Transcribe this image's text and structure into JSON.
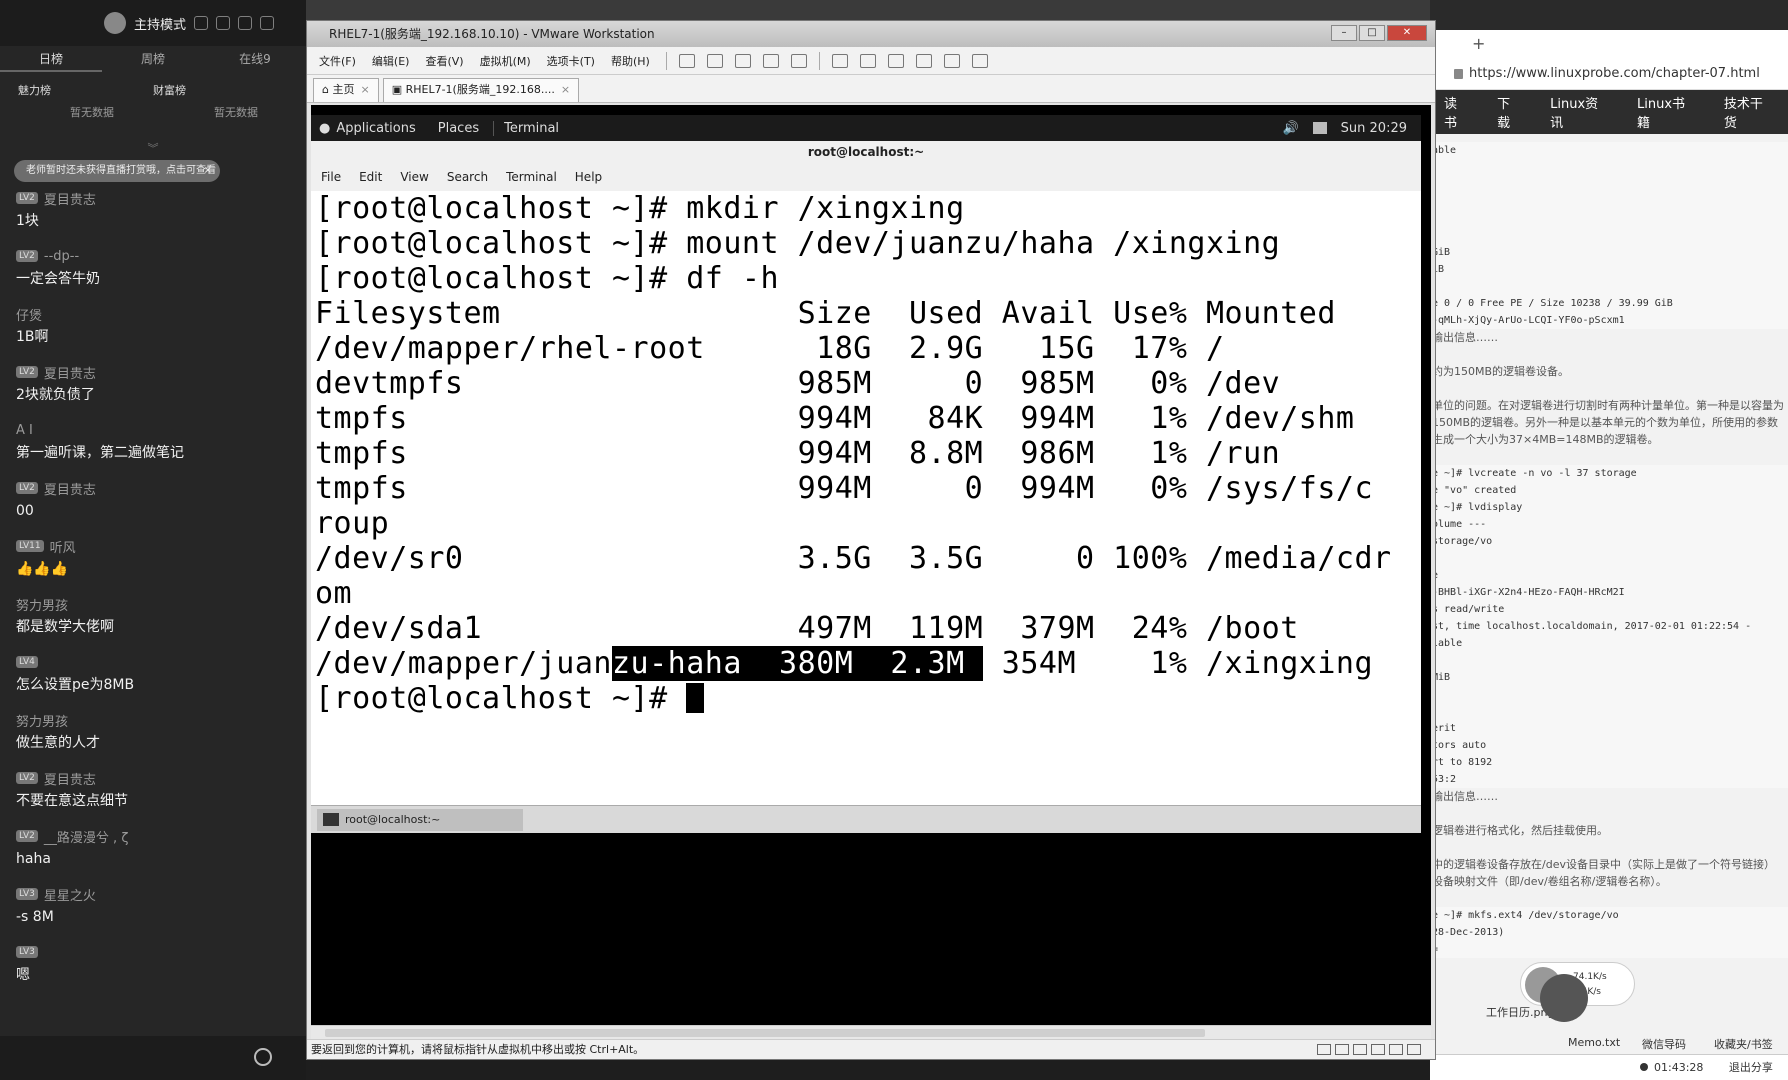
{
  "live_panel": {
    "mode_label": "主持模式",
    "tabs": [
      "日榜",
      "周榜",
      "在线9"
    ],
    "rank_labels": [
      "魅力榜",
      "财富榜"
    ],
    "no_data": [
      "暂无数据",
      "暂无数据"
    ],
    "notice": "老师暂时还未获得直播打赏哦，点击可查看",
    "notice_close": "×",
    "messages": [
      {
        "level": "LV2",
        "user": "夏目贵志",
        "text": "1块"
      },
      {
        "level": "LV2",
        "user": "--dp--",
        "text": "一定会答牛奶"
      },
      {
        "level": "",
        "user": "仔煲",
        "text": "1B啊"
      },
      {
        "level": "LV2",
        "user": "夏目贵志",
        "text": "2块就负债了"
      },
      {
        "level": "",
        "user": "A   I",
        "text": "第一遍听课，第二遍做笔记"
      },
      {
        "level": "LV2",
        "user": "夏目贵志",
        "text": "00"
      },
      {
        "level": "LV11",
        "user": "听风",
        "text": "👍👍👍"
      },
      {
        "level": "",
        "user": "努力男孩",
        "text": "都是数学大佬啊"
      },
      {
        "level": "LV4",
        "user": "",
        "text": "怎么设置pe为8MB"
      },
      {
        "level": "",
        "user": "努力男孩",
        "text": "做生意的人才"
      },
      {
        "level": "LV2",
        "user": "夏目贵志",
        "text": "不要在意这点细节"
      },
      {
        "level": "LV2",
        "user": "__路漫漫兮 , ζ",
        "text": "haha"
      },
      {
        "level": "LV3",
        "user": "星星之火",
        "text": "-s 8M"
      },
      {
        "level": "LV3",
        "user": "",
        "text": "嗯"
      }
    ]
  },
  "vmware": {
    "title": "RHEL7-1(服务端_192.168.10.10) - VMware Workstation",
    "menu": [
      "文件(F)",
      "编辑(E)",
      "查看(V)",
      "虚拟机(M)",
      "选项卡(T)",
      "帮助(H)"
    ],
    "tabs": [
      {
        "label": "主页"
      },
      {
        "label": "RHEL7-1(服务端_192.168...."
      }
    ],
    "status_text": "要返回到您的计算机，请将鼠标指针从虚拟机中移出或按 Ctrl+Alt。"
  },
  "gnome": {
    "applications": "Applications",
    "places": "Places",
    "terminal_indicator": "Terminal",
    "clock": "Sun 20:29"
  },
  "terminal": {
    "title": "root@localhost:~",
    "menu": [
      "File",
      "Edit",
      "View",
      "Search",
      "Terminal",
      "Help"
    ],
    "lines": [
      "[root@localhost ~]# mkdir /xingxing",
      "[root@localhost ~]# mount /dev/juanzu/haha /xingxing",
      "[root@localhost ~]# df -h",
      "Filesystem                Size  Used Avail Use% Mounted",
      "/dev/mapper/rhel-root      18G  2.9G   15G  17% /",
      "devtmpfs                  985M     0  985M   0% /dev",
      "tmpfs                     994M   84K  994M   1% /dev/shm",
      "tmpfs                     994M  8.8M  986M   1% /run",
      "tmpfs                     994M     0  994M   0% /sys/fs/c",
      "roup",
      "/dev/sr0                  3.5G  3.5G     0 100% /media/cdr",
      "om",
      "/dev/sda1                 497M  119M  379M  24% /boot"
    ],
    "last_row_a": "/dev/mapper/juan",
    "last_row_hl": "zu-haha  380M  2.3M ",
    "last_row_b": " 354M    1% /xingxing",
    "prompt": "[root@localhost ~]# ",
    "taskbar_item": "root@localhost:~"
  },
  "browser": {
    "new_tab": "+",
    "url": "https://www.linuxprobe.com/chapter-07.html",
    "nav": [
      "读书",
      "下载",
      "Linux资讯",
      "Linux书籍",
      "技术干货"
    ],
    "lines": [
      {
        "t": "able",
        "k": "mono"
      },
      {
        "t": "",
        "k": "mono"
      },
      {
        "t": "",
        "k": "mono"
      },
      {
        "t": "",
        "k": "mono"
      },
      {
        "t": "",
        "k": "mono"
      },
      {
        "t": "",
        "k": "mono"
      },
      {
        "t": "GiB",
        "k": "mono"
      },
      {
        "t": "iB",
        "k": "mono"
      },
      {
        "t": "",
        "k": "mono"
      },
      {
        "t": "e 0 / 0   Free PE / Size 10238 / 39.99 GiB",
        "k": "mono"
      },
      {
        "t": "-qMLh-XjQy-ArUo-LCQI-YF0o-pScxm1",
        "k": "mono"
      },
      {
        "t": "输出信息……",
        "k": "cn"
      },
      {
        "t": "",
        "k": "cn"
      },
      {
        "t": "约为150MB的逻辑卷设备。",
        "k": "cn"
      },
      {
        "t": "",
        "k": "cn"
      },
      {
        "t": "单位的问题。在对逻辑卷进行切割时有两种计量单位。第一种是以容量为",
        "k": "cn"
      },
      {
        "t": "150MB的逻辑卷。另外一种是以基本单元的个数为单位，所使用的参数",
        "k": "cn"
      },
      {
        "t": "生成一个大小为37×4MB=148MB的逻辑卷。",
        "k": "cn"
      },
      {
        "t": "",
        "k": "cn"
      },
      {
        "t": "e ~]# lvcreate -n vo -l 37 storage",
        "k": "mono"
      },
      {
        "t": "e \"vo\" created",
        "k": "mono"
      },
      {
        "t": "e ~]# lvdisplay",
        "k": "mono"
      },
      {
        "t": "olume ---",
        "k": "mono"
      },
      {
        "t": "storage/vo",
        "k": "mono"
      },
      {
        "t": "",
        "k": "mono"
      },
      {
        "t": "e",
        "k": "mono"
      },
      {
        "t": "-BHBl-iXGr-X2n4-HEzo-FAQH-HRcM2I",
        "k": "mono"
      },
      {
        "t": "s read/write",
        "k": "mono"
      },
      {
        "t": "st, time localhost.localdomain, 2017-02-01 01:22:54 -",
        "k": "mono"
      },
      {
        "t": "lable",
        "k": "mono"
      },
      {
        "t": "",
        "k": "mono"
      },
      {
        "t": "MiB",
        "k": "mono"
      },
      {
        "t": "",
        "k": "mono"
      },
      {
        "t": "",
        "k": "mono"
      },
      {
        "t": "erit",
        "k": "mono"
      },
      {
        "t": "tors auto",
        "k": "mono"
      },
      {
        "t": "rt to 8192",
        "k": "mono"
      },
      {
        "t": "53:2",
        "k": "mono"
      },
      {
        "t": "输出信息……",
        "k": "cn"
      },
      {
        "t": "",
        "k": "cn"
      },
      {
        "t": "逻辑卷进行格式化，然后挂载使用。",
        "k": "cn"
      },
      {
        "t": "",
        "k": "cn"
      },
      {
        "t": "中的逻辑卷设备存放在/dev设备目录中（实际上是做了一个符号链接）",
        "k": "cn"
      },
      {
        "t": "设备映射文件（即/dev/卷组名称/逻辑卷名称）。",
        "k": "cn"
      },
      {
        "t": "",
        "k": "cn"
      },
      {
        "t": "e ~]# mkfs.ext4 /dev/storage/vo",
        "k": "mono"
      },
      {
        "t": "28-Dec-2013)",
        "k": "mono"
      },
      {
        "t": "=",
        "k": "mono"
      }
    ],
    "speed_up": "74.1K/s",
    "speed_down": "2.4K/s",
    "dock": [
      "工作日历.png",
      "Memo.txt",
      "微信导码",
      "收藏夹/书签"
    ],
    "timer": "01:43:28",
    "exit_share": "退出分享"
  }
}
